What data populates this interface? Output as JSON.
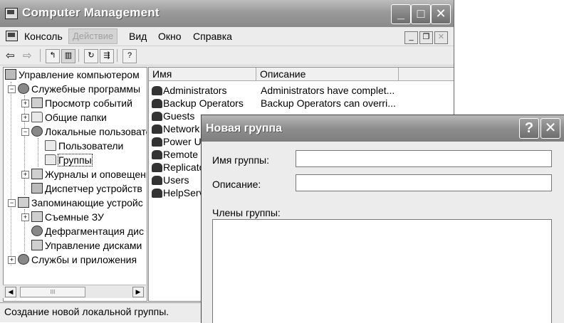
{
  "window": {
    "title": "Computer Management",
    "controls": {
      "minimize": "_",
      "maximize": "□",
      "close": "✕"
    }
  },
  "menubar": {
    "items": [
      "Консоль",
      "Действие",
      "Вид",
      "Окно",
      "Справка"
    ],
    "disabled_item": "Действие",
    "child_controls": {
      "minimize": "_",
      "restore": "❐",
      "close": "✕"
    }
  },
  "toolbar": {
    "buttons": [
      "back-icon",
      "forward-icon",
      "up-folder-icon",
      "show-tree-icon",
      "refresh-icon",
      "export-list-icon",
      "help-icon"
    ]
  },
  "tree": {
    "items": [
      {
        "label": "Управление компьютером",
        "icon": "computer-icon"
      },
      {
        "label": "Служебные программы",
        "icon": "tools-icon",
        "expander": "−"
      },
      {
        "label": "Просмотр событий",
        "icon": "event-viewer-icon",
        "expander": "+"
      },
      {
        "label": "Общие папки",
        "icon": "shared-folders-icon",
        "expander": "+"
      },
      {
        "label": "Локальные пользовате",
        "icon": "users-icon",
        "expander": "−"
      },
      {
        "label": "Пользователи",
        "icon": "folder-icon"
      },
      {
        "label": "Группы",
        "icon": "folder-open-icon"
      },
      {
        "label": "Журналы и оповещени",
        "icon": "logs-icon",
        "expander": "+"
      },
      {
        "label": "Диспетчер устройств",
        "icon": "device-manager-icon"
      },
      {
        "label": "Запоминающие устройс",
        "icon": "storage-icon",
        "expander": "−"
      },
      {
        "label": "Съемные ЗУ",
        "icon": "removable-storage-icon",
        "expander": "+"
      },
      {
        "label": "Дефрагментация дис",
        "icon": "defrag-icon"
      },
      {
        "label": "Управление дисками",
        "icon": "disk-management-icon"
      },
      {
        "label": "Службы и приложения",
        "icon": "services-icon",
        "expander": "+"
      }
    ],
    "scroll": {
      "left": "◀",
      "right": "▶",
      "thumb": "III"
    }
  },
  "list": {
    "columns": [
      "Имя",
      "Описание"
    ],
    "rows": [
      {
        "name": "Administrators",
        "description": "Administrators have complet..."
      },
      {
        "name": "Backup Operators",
        "description": "Backup Operators can overri..."
      },
      {
        "name": "Guests",
        "description": ""
      },
      {
        "name": "Network",
        "description": ""
      },
      {
        "name": "Power U",
        "description": ""
      },
      {
        "name": "Remote",
        "description": ""
      },
      {
        "name": "Replicato",
        "description": ""
      },
      {
        "name": "Users",
        "description": ""
      },
      {
        "name": "HelpServ",
        "description": ""
      }
    ],
    "row_icon": "group-icon"
  },
  "statusbar": {
    "text": "Создание новой локальной группы."
  },
  "dialog": {
    "title": "Новая группа",
    "controls": {
      "help": "?",
      "close": "✕"
    },
    "group_name_label": "Имя группы:",
    "group_name_value": "",
    "description_label": "Описание:",
    "description_value": "",
    "members_label": "Члены группы:"
  }
}
